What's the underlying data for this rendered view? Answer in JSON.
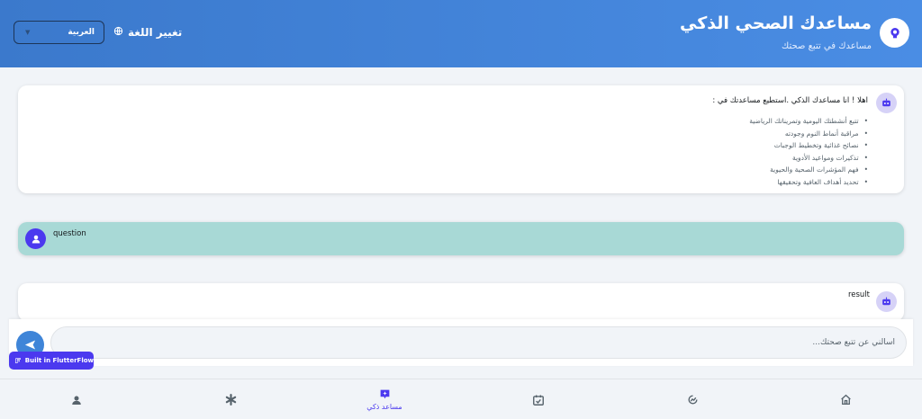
{
  "header": {
    "title": "مساعدك الصحي الذكي",
    "subtitle": "مساعدك في تتبع صحتك",
    "change_language_label": "تغيير اللغة",
    "language_value": "العربية"
  },
  "bot_message": {
    "greeting": "اهلا ! انا مساعدك الذكي .استطيع مساعدتك في :",
    "features": [
      "تتبع أنشطتك اليومية وتمريناتك الرياضية",
      "مراقبة أنماط النوم وجودته",
      "نصائح غذائية وتخطيط الوجبات",
      "تذكيرات ومواعيد الأدوية",
      "فهم المؤشرات الصحية والحيوية",
      "تحديد أهداف العافية وتحقيقها"
    ]
  },
  "question_message": {
    "text": "question"
  },
  "result_message": {
    "text": "result"
  },
  "input": {
    "placeholder": "اسالني عن تتبع صحتك..."
  },
  "badge": {
    "label": "Built in FlutterFlow"
  },
  "nav": {
    "active_label": "مساعد ذكي"
  },
  "colors": {
    "header_start": "#3b79cc",
    "header_end": "#4a8de4",
    "primary": "#4b39ef",
    "question_bg": "#a8d9d6",
    "send_button": "#3f85d8"
  }
}
